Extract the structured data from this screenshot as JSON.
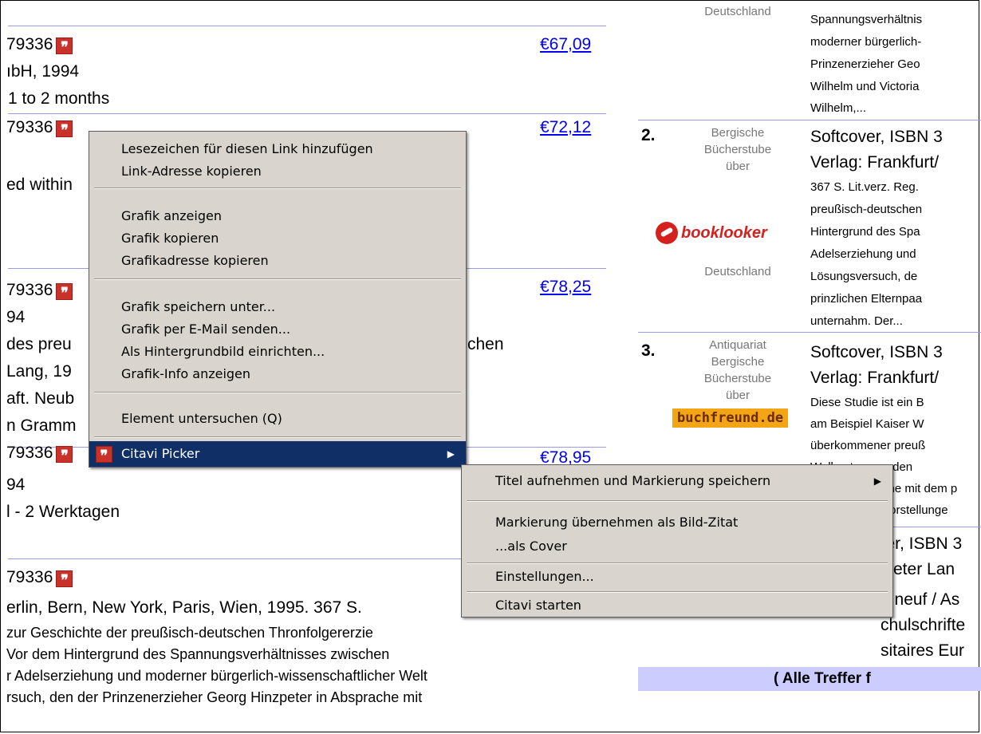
{
  "left_listing": {
    "rows": [
      {
        "isbn_tail": "79336",
        "price": "€67,09",
        "line2": "ıbH, 1994",
        "line3": "1 to 2 months"
      },
      {
        "isbn_tail": "79336",
        "price": "€72,12",
        "line2": "ed within"
      },
      {
        "isbn_tail": "79336",
        "price": "€78,25",
        "line2": "94",
        "line3": " des preu",
        "line3b": "chen",
        "line4": "Lang, 19",
        "line5": "aft. Neub",
        "line6": "n Gramm"
      },
      {
        "isbn_tail": "79336",
        "price": "€78,95",
        "line2": "94",
        "line3": "l - 2 Werktagen"
      },
      {
        "isbn_tail": "79336",
        "line2": "erlin, Bern, New York, Paris, Wien, 1995. 367 S.",
        "desc": [
          " zur Geschichte der preußisch-deutschen Thronfolgererzie",
          "Vor dem Hintergrund des Spannungsverhältnisses zwischen",
          "r Adelserziehung und moderner bürgerlich-wissenschaftlicher Welt",
          "rsuch, den der Prinzenerzieher Georg Hinzpeter in Absprache mit"
        ]
      }
    ]
  },
  "right_listing": {
    "top_country": "Deutschland",
    "top_desc": [
      "Spannungsverhältnis",
      "moderner bürgerlich-",
      "Prinzenerzieher Geo",
      "Wilhelm und Victoria",
      "Wilhelm,..."
    ],
    "entries": [
      {
        "num": "2.",
        "seller": [
          "Bergische",
          "Bücherstube",
          "über"
        ],
        "logo": "booklooker",
        "country": "Deutschland",
        "title1": "Softcover, ISBN 3",
        "title2": "Verlag: Frankfurt/",
        "desc": [
          "367 S. Lit.verz. Reg.",
          "preußisch-deutschen",
          "Hintergrund des Spa",
          "Adelserziehung und",
          "Lösungsversuch, de",
          "prinzlichen Elternpaa",
          "unternahm. Der..."
        ]
      },
      {
        "num": "3.",
        "seller": [
          "Antiquariat",
          "Bergische",
          "Bücherstube",
          "über"
        ],
        "logo": "buchfreund.de",
        "title1": "Softcover, ISBN 3",
        "title2": "Verlag: Frankfurt/",
        "desc": [
          "Diese Studie ist ein B",
          "am Beispiel Kaiser W",
          "überkommener preuß",
          "Wellenıt es um den",
          "che mit dem p",
          "Vorstellunge"
        ]
      },
      {
        "title1": "ver, ISBN 3",
        "title2": "Peter Lan",
        "line3": "e neuf / As",
        "line4": "chulschrifte",
        "line5": "sitaires Eur"
      }
    ],
    "footer": "( Alle Treffer f"
  },
  "context_menu": {
    "items": [
      {
        "label": "Lesezeichen für diesen Link hinzufügen",
        "u": "L"
      },
      {
        "label": "Link-Adresse kopieren",
        "u": "k"
      },
      {
        "sep": true
      },
      {
        "label": "Grafik anzeigen",
        "u": "r"
      },
      {
        "label": "Grafik kopieren",
        "u": "o"
      },
      {
        "label": "Grafikadresse kopieren",
        "u": "d"
      },
      {
        "sep": true
      },
      {
        "label": "Grafik speichern unter...",
        "u": "u"
      },
      {
        "label": "Grafik per E-Mail senden...",
        "u": "n"
      },
      {
        "label": "Als Hintergrundbild einrichten...",
        "u": "A"
      },
      {
        "label": "Grafik-Info anzeigen",
        "u": "z"
      },
      {
        "sep": true
      },
      {
        "label": "Element untersuchen (Q)",
        "u": "Q"
      },
      {
        "sep": true
      },
      {
        "label": "Citavi Picker",
        "u": "C",
        "submenu": true,
        "highlighted": true
      }
    ]
  },
  "submenu": {
    "items": [
      {
        "label": "Titel aufnehmen und Markierung speichern",
        "submenu": true
      },
      {
        "sep": true
      },
      {
        "label": "Markierung übernehmen als Bild-Zitat"
      },
      {
        "label": "...als Cover"
      },
      {
        "sep": true
      },
      {
        "label": "Einstellungen..."
      },
      {
        "sep": true
      },
      {
        "label": "Citavi starten"
      }
    ]
  },
  "icons": {
    "quote": "citavi-quote-icon"
  }
}
